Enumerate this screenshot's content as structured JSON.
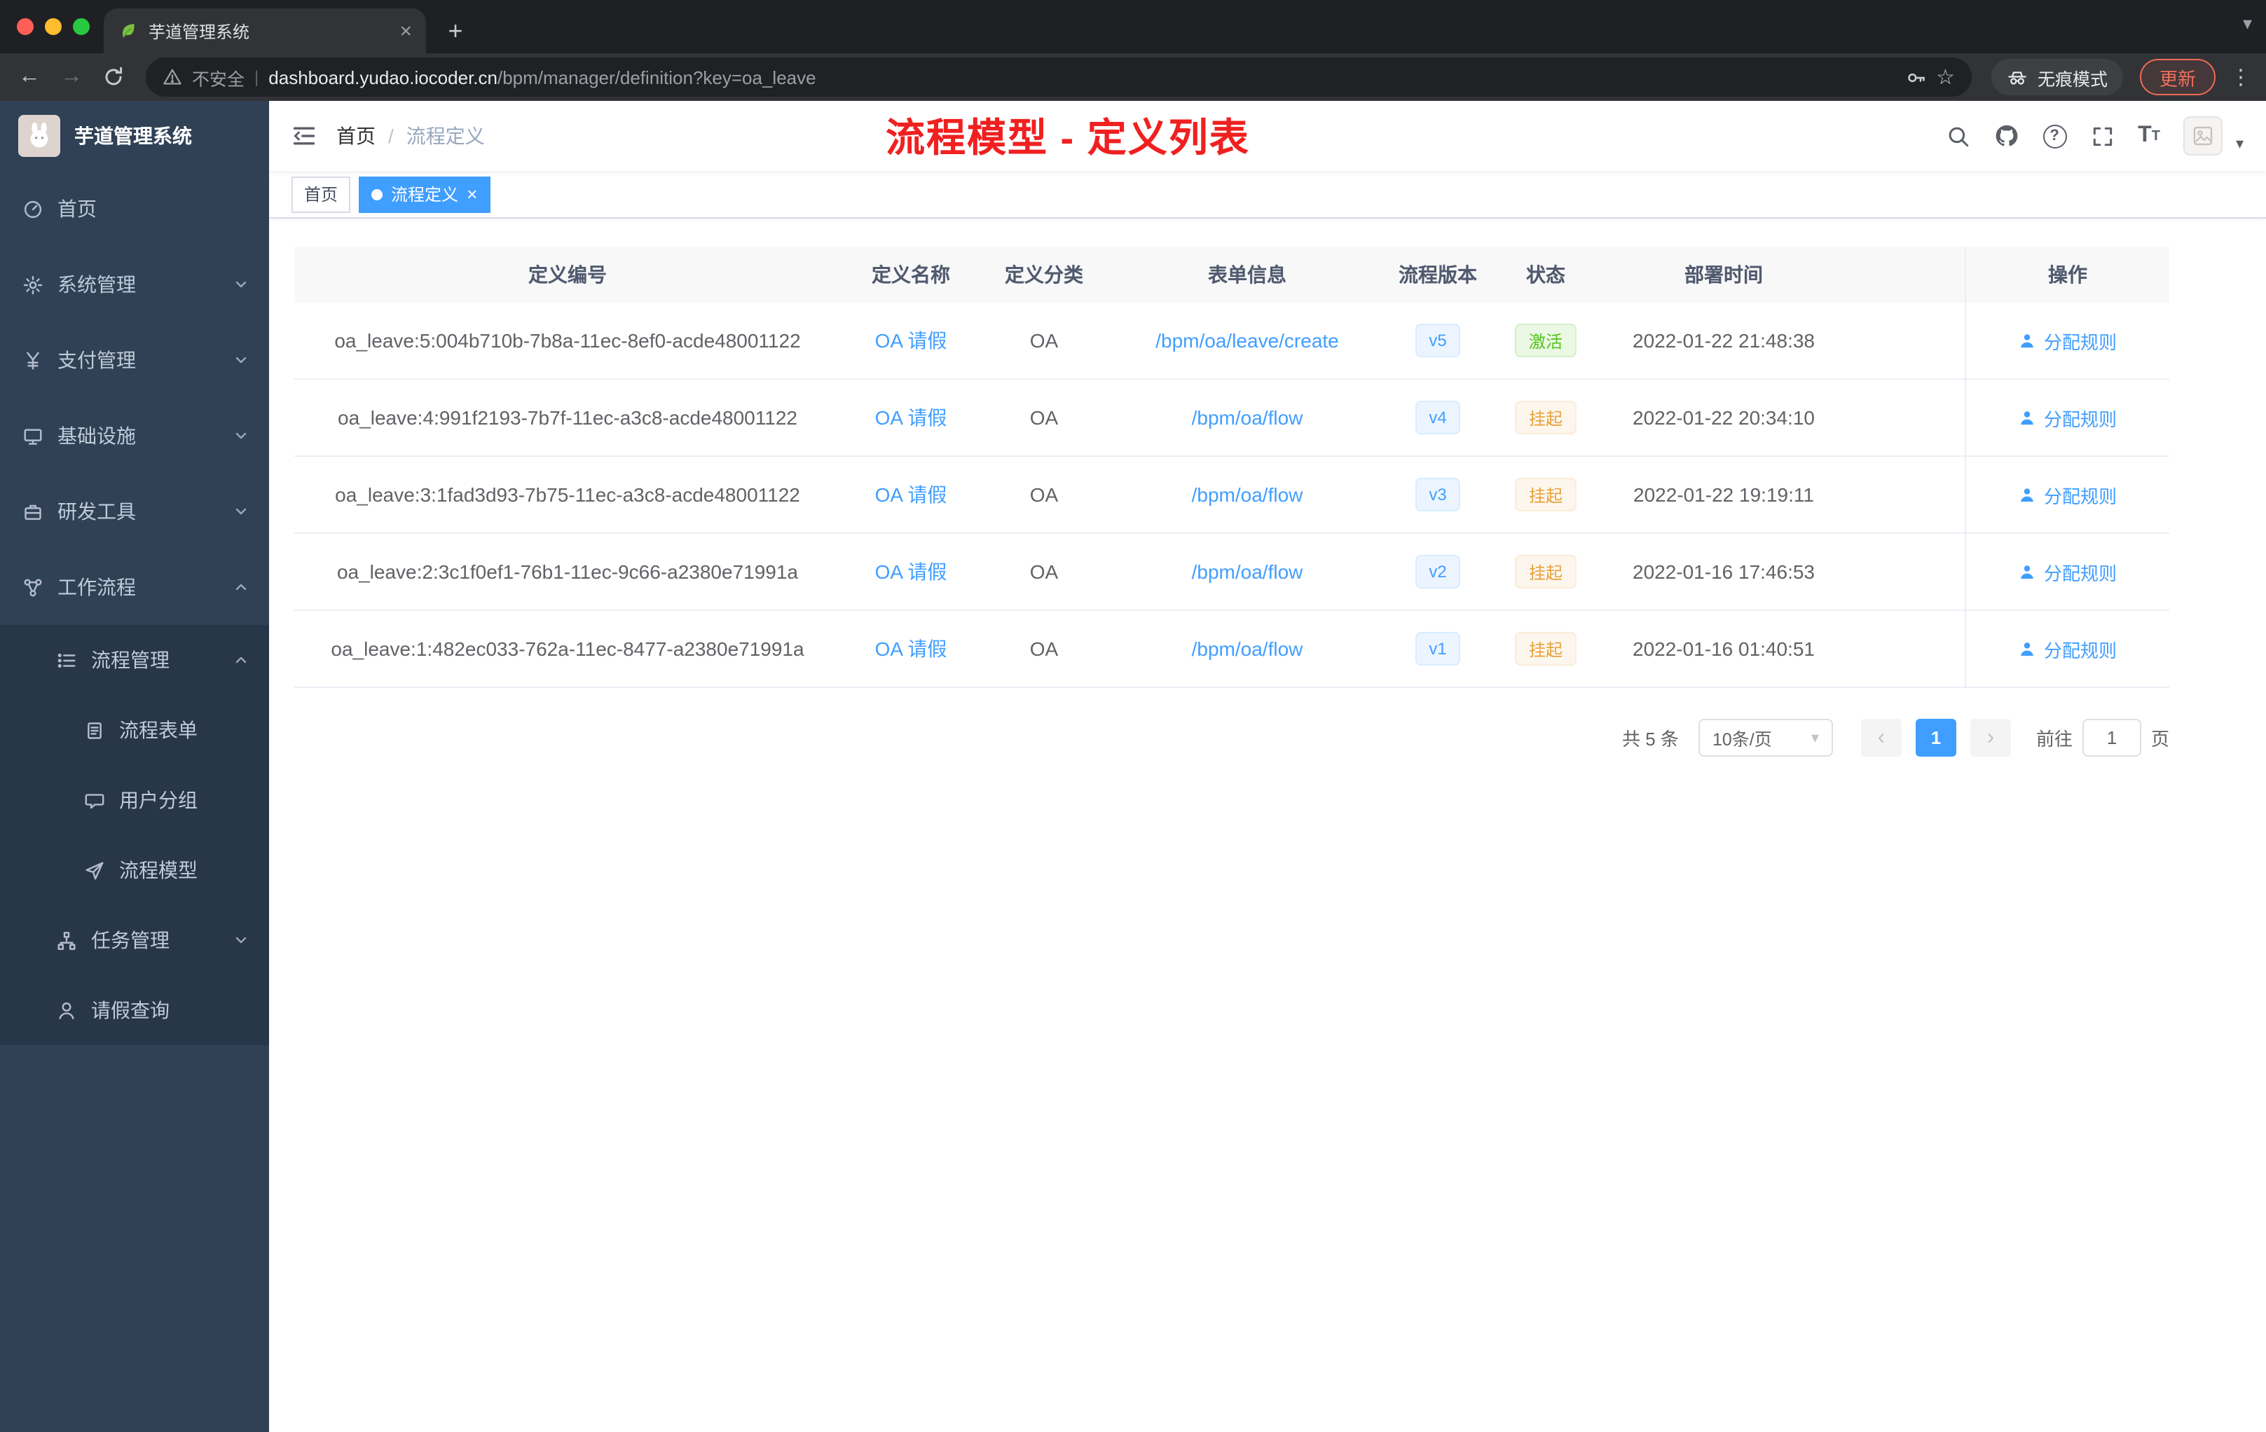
{
  "browser": {
    "tab": {
      "title": "芋道管理系统"
    },
    "address": {
      "security_label": "不安全",
      "separator": "|",
      "domain": "dashboard.yudao.iocoder.cn",
      "path": "/bpm/manager/definition?key=oa_leave"
    },
    "incognito_label": "无痕模式",
    "update_label": "更新"
  },
  "glyphs": {
    "close": "×",
    "plus": "+",
    "back": "←",
    "forward": "→",
    "overflow": "⋮",
    "star": "☆",
    "caret_down": "▾",
    "prev": "‹",
    "next": "›",
    "question": "?",
    "font_size": "T"
  },
  "sidebar": {
    "app_title": "芋道管理系统",
    "items": [
      {
        "label": "首页",
        "icon": "dashboard-icon"
      },
      {
        "label": "系统管理",
        "icon": "gear-icon",
        "expand": "down"
      },
      {
        "label": "支付管理",
        "icon": "yen-icon",
        "expand": "down"
      },
      {
        "label": "基础设施",
        "icon": "monitor-icon",
        "expand": "down"
      },
      {
        "label": "研发工具",
        "icon": "toolbox-icon",
        "expand": "down"
      },
      {
        "label": "工作流程",
        "icon": "workflow-icon",
        "expand": "up"
      },
      {
        "label": "流程管理",
        "icon": "list-icon",
        "expand": "up"
      },
      {
        "label": "流程表单",
        "icon": "form-icon"
      },
      {
        "label": "用户分组",
        "icon": "chat-icon"
      },
      {
        "label": "流程模型",
        "icon": "send-icon"
      },
      {
        "label": "任务管理",
        "icon": "tree-icon",
        "expand": "down"
      },
      {
        "label": "请假查询",
        "icon": "user-icon"
      }
    ]
  },
  "header": {
    "breadcrumb": {
      "home": "首页",
      "separator": "/",
      "current": "流程定义"
    },
    "annotation": "流程模型 - 定义列表"
  },
  "tags": {
    "items": [
      {
        "label": "首页",
        "active": false
      },
      {
        "label": "流程定义",
        "active": true
      }
    ]
  },
  "table": {
    "columns": [
      "定义编号",
      "定义名称",
      "定义分类",
      "表单信息",
      "流程版本",
      "状态",
      "部署时间",
      "操作"
    ],
    "rows": [
      {
        "id": "oa_leave:5:004b710b-7b8a-11ec-8ef0-acde48001122",
        "name": "OA 请假",
        "category": "OA",
        "form": "/bpm/oa/leave/create",
        "version": "v5",
        "status": "激活",
        "time": "2022-01-22 21:48:38",
        "action": "分配规则"
      },
      {
        "id": "oa_leave:4:991f2193-7b7f-11ec-a3c8-acde48001122",
        "name": "OA 请假",
        "category": "OA",
        "form": "/bpm/oa/flow",
        "version": "v4",
        "status": "挂起",
        "time": "2022-01-22 20:34:10",
        "action": "分配规则"
      },
      {
        "id": "oa_leave:3:1fad3d93-7b75-11ec-a3c8-acde48001122",
        "name": "OA 请假",
        "category": "OA",
        "form": "/bpm/oa/flow",
        "version": "v3",
        "status": "挂起",
        "time": "2022-01-22 19:19:11",
        "action": "分配规则"
      },
      {
        "id": "oa_leave:2:3c1f0ef1-76b1-11ec-9c66-a2380e71991a",
        "name": "OA 请假",
        "category": "OA",
        "form": "/bpm/oa/flow",
        "version": "v2",
        "status": "挂起",
        "time": "2022-01-16 17:46:53",
        "action": "分配规则"
      },
      {
        "id": "oa_leave:1:482ec033-762a-11ec-8477-a2380e71991a",
        "name": "OA 请假",
        "category": "OA",
        "form": "/bpm/oa/flow",
        "version": "v1",
        "status": "挂起",
        "time": "2022-01-16 01:40:51",
        "action": "分配规则"
      }
    ]
  },
  "pagination": {
    "total": "共 5 条",
    "page_size": "10条/页",
    "current_page": "1",
    "goto_label": "前往",
    "goto_value": "1",
    "goto_unit": "页"
  },
  "colors": {
    "accent": "#409eff",
    "annotation_red": "#f02020",
    "status_active": "#52c41a",
    "status_suspended": "#e6a23c",
    "sidebar_bg": "#304156"
  }
}
